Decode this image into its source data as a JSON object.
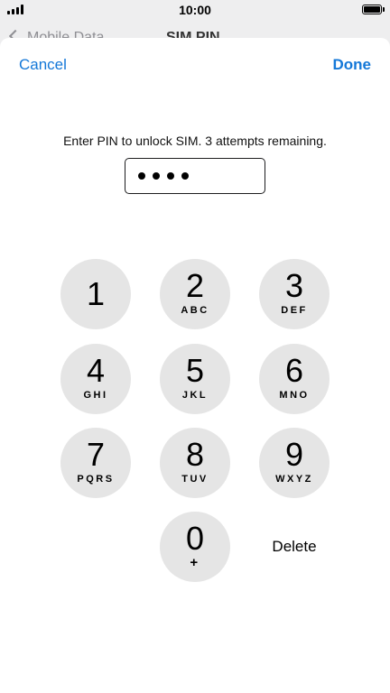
{
  "status_bar": {
    "time": "10:00"
  },
  "background": {
    "back_label": "Mobile Data",
    "title": "SIM PIN"
  },
  "nav": {
    "cancel_label": "Cancel",
    "done_label": "Done"
  },
  "prompt": "Enter PIN to unlock SIM. 3 attempts remaining.",
  "pin_field": {
    "entered_digits": 4
  },
  "keypad": [
    {
      "digit": "1",
      "letters": ""
    },
    {
      "digit": "2",
      "letters": "ABC"
    },
    {
      "digit": "3",
      "letters": "DEF"
    },
    {
      "digit": "4",
      "letters": "GHI"
    },
    {
      "digit": "5",
      "letters": "JKL"
    },
    {
      "digit": "6",
      "letters": "MNO"
    },
    {
      "digit": "7",
      "letters": "PQRS"
    },
    {
      "digit": "8",
      "letters": "TUV"
    },
    {
      "digit": "9",
      "letters": "WXYZ"
    },
    {
      "digit": "0",
      "letters": "+"
    }
  ],
  "delete_label": "Delete",
  "colors": {
    "accent": "#1478d8",
    "key_background": "#e5e5e5"
  },
  "icons": {
    "signal": "cellular-signal-icon",
    "battery": "battery-icon",
    "back": "chevron-left-icon"
  }
}
